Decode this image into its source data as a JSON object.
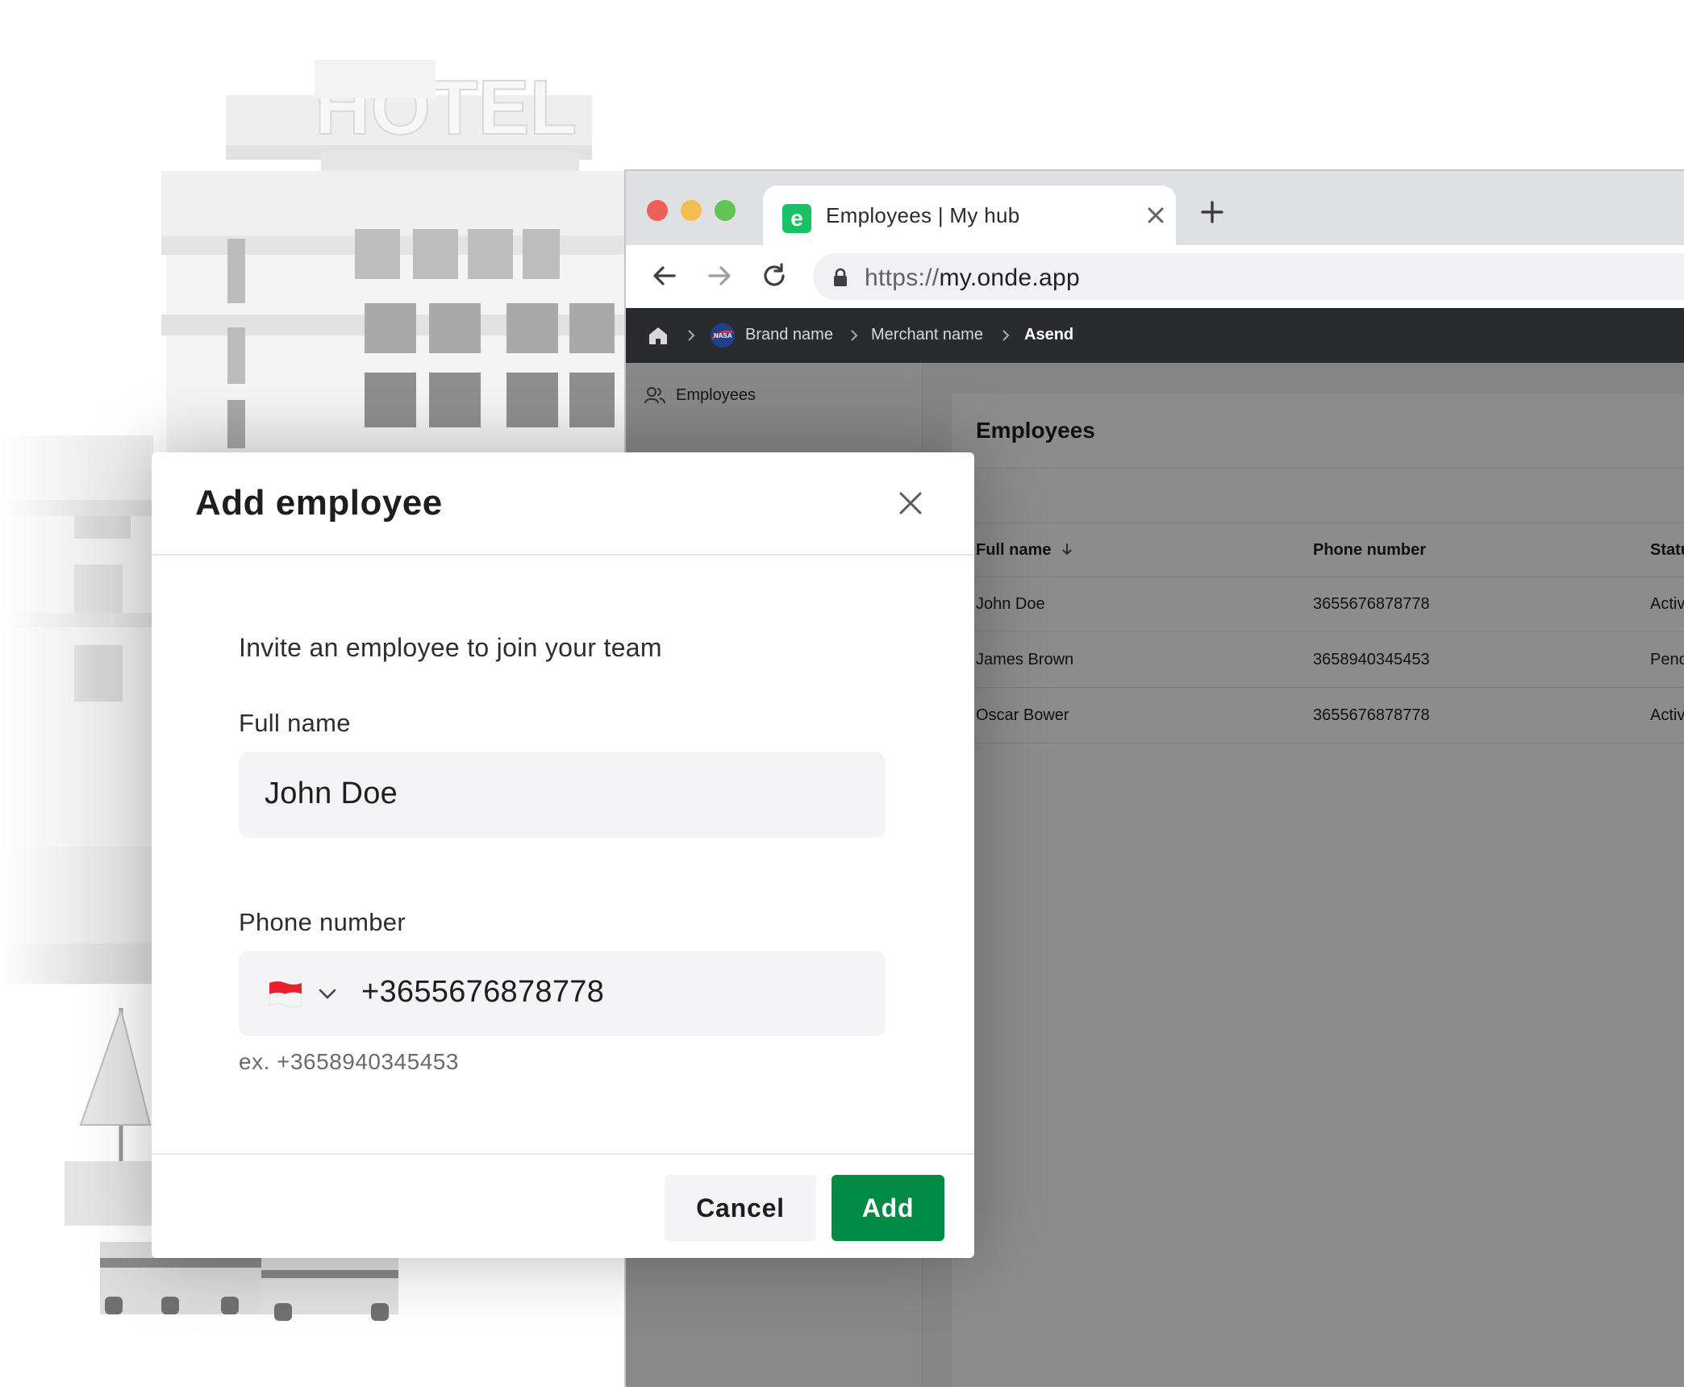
{
  "background": {
    "sign_text": "HOTEL"
  },
  "browser": {
    "window_controls": [
      "close",
      "minimize",
      "maximize"
    ],
    "tab": {
      "title": "Employees | My hub",
      "favicon": "e"
    },
    "address_bar": {
      "protocol": "https://",
      "host": "my.onde.app"
    },
    "breadcrumb": {
      "items": [
        "Brand name",
        "Merchant name",
        "Asend"
      ]
    }
  },
  "sidebar": {
    "items": [
      {
        "label": "Employees",
        "icon": "users-icon"
      }
    ]
  },
  "panel": {
    "title": "Employees",
    "columns": [
      "Full name",
      "Phone number",
      "Statu"
    ],
    "rows": [
      {
        "name": "John Doe",
        "phone": "3655676878778",
        "status": "Activ"
      },
      {
        "name": "James Brown",
        "phone": "3658940345453",
        "status": "Penc"
      },
      {
        "name": "Oscar Bower",
        "phone": "3655676878778",
        "status": "Activ"
      }
    ]
  },
  "modal": {
    "title": "Add employee",
    "subtitle": "Invite an employee to join your team",
    "full_name": {
      "label": "Full name",
      "value": "John Doe"
    },
    "phone": {
      "label": "Phone number",
      "value": "+3655676878778",
      "hint": "ex. +3658940345453",
      "country_flag_colors": [
        "#e8202e",
        "#ffffff"
      ]
    },
    "buttons": {
      "cancel": "Cancel",
      "add": "Add"
    }
  },
  "colors": {
    "primary": "#008a43",
    "favicon_green": "#18c264",
    "appbar": "#2a2b2e",
    "mac_close": "#ed5f57",
    "mac_min": "#f4bd4f",
    "mac_max": "#61c454"
  }
}
